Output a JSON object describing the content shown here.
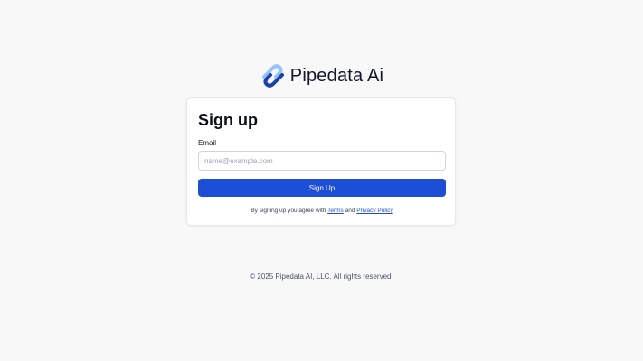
{
  "brand": {
    "name": "Pipedata Ai",
    "logo_icon": "pipedata-logo-icon",
    "colors": {
      "logo_light": "#93c5fd",
      "logo_dark": "#1e40af"
    }
  },
  "card": {
    "title": "Sign up",
    "email_label": "Email",
    "email_placeholder": "name@example.com",
    "email_value": "",
    "button_label": "Sign Up",
    "agree_prefix": "By signing up you agree with",
    "terms_link": "Terms",
    "agree_and": "and",
    "privacy_link": "Privacy Policy"
  },
  "footer": {
    "copyright": "© 2025 Pipedata AI, LLC. All rights reserved."
  },
  "colors": {
    "accent": "#1d4ed8",
    "background": "#f8f8f8",
    "card": "#ffffff"
  }
}
